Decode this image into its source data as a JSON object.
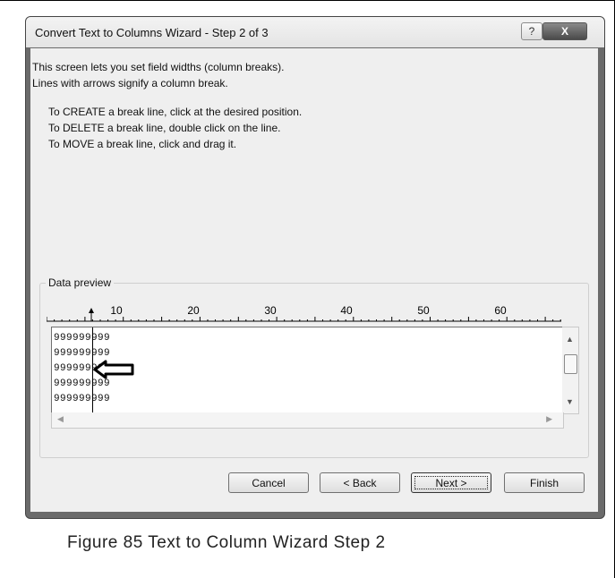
{
  "dialog": {
    "title": "Convert Text to Columns Wizard - Step 2 of 3",
    "help_label": "?",
    "close_label": "X"
  },
  "instructions": {
    "lines": [
      "This screen lets you set field widths (column breaks).",
      "Lines with arrows signify a column break."
    ]
  },
  "steps": {
    "lines": [
      "To CREATE a break line, click at the desired position.",
      "To DELETE a break line, double click on the line.",
      "To MOVE a break line, click and drag it."
    ]
  },
  "data_preview": {
    "label": "Data preview",
    "ruler_ticks": [
      "10",
      "20",
      "30",
      "40",
      "50",
      "60"
    ],
    "rows": [
      "999999999",
      "999999999",
      "999999999",
      "999999999",
      "999999999"
    ]
  },
  "buttons": {
    "cancel": "Cancel",
    "back": "< Back",
    "next": "Next >",
    "finish": "Finish"
  },
  "caption": "Figure 85 Text to Column Wizard Step 2"
}
